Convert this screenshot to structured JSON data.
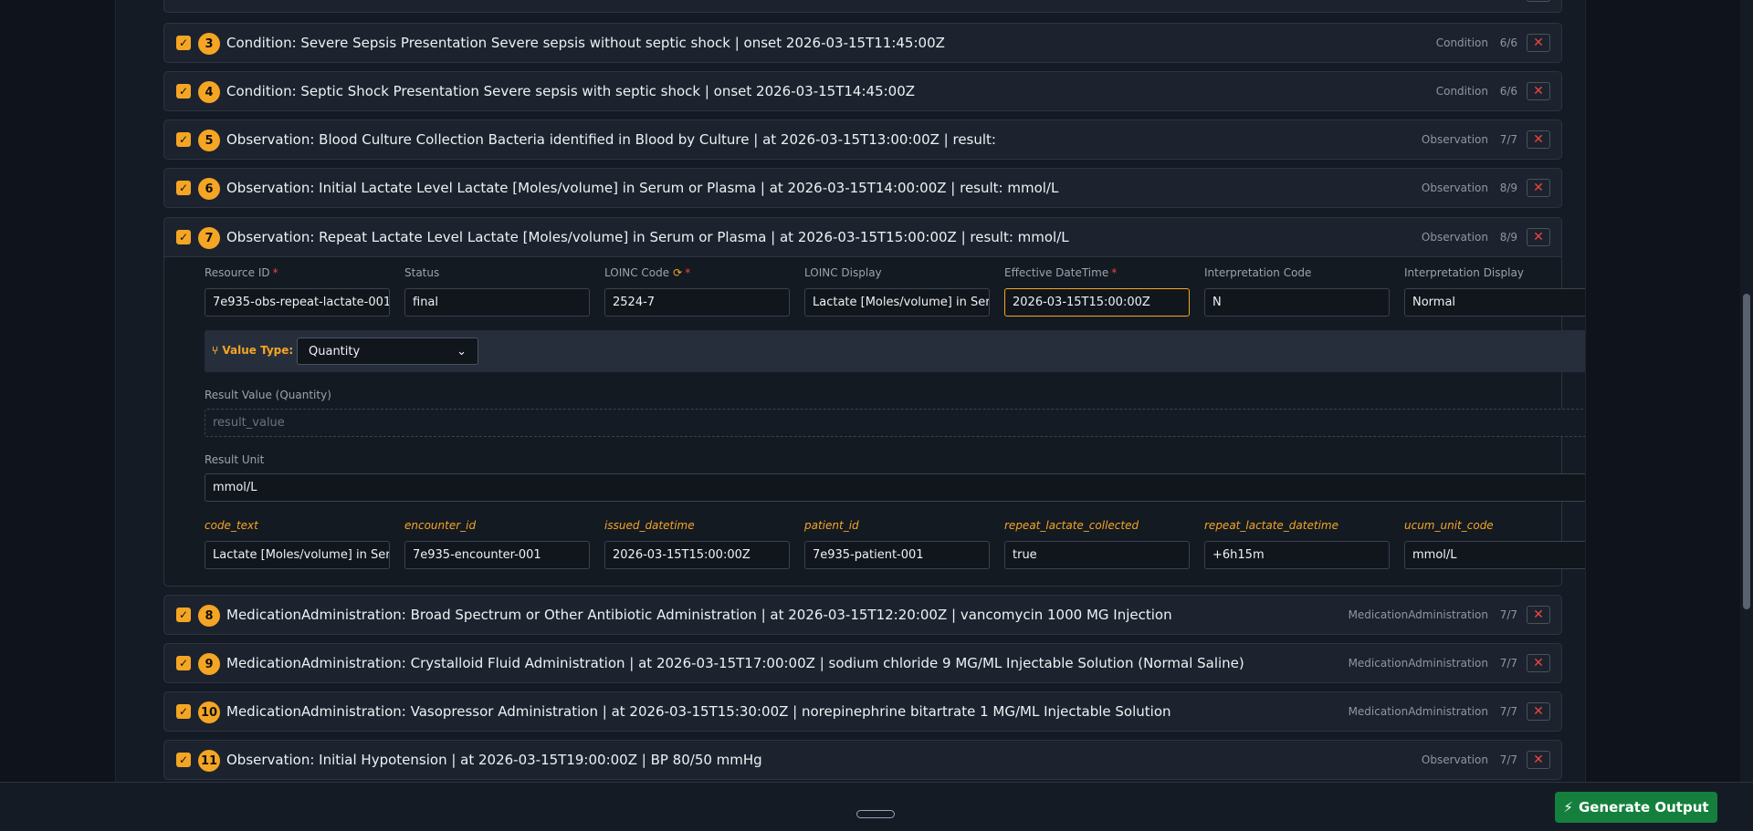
{
  "rows": [
    {
      "num": "3",
      "title": "Condition: Severe Sepsis Presentation Severe sepsis without septic shock | onset 2026-03-15T11:45:00Z",
      "type": "Condition",
      "count": "6/6"
    },
    {
      "num": "4",
      "title": "Condition: Septic Shock Presentation Severe sepsis with septic shock | onset 2026-03-15T14:45:00Z",
      "type": "Condition",
      "count": "6/6"
    },
    {
      "num": "5",
      "title": "Observation: Blood Culture Collection Bacteria identified in Blood by Culture | at 2026-03-15T13:00:00Z | result:",
      "type": "Observation",
      "count": "7/7"
    },
    {
      "num": "6",
      "title": "Observation: Initial Lactate Level Lactate [Moles/volume] in Serum or Plasma | at 2026-03-15T14:00:00Z | result: mmol/L",
      "type": "Observation",
      "count": "8/9"
    },
    {
      "num": "7",
      "title": "Observation: Repeat Lactate Level Lactate [Moles/volume] in Serum or Plasma | at 2026-03-15T15:00:00Z | result: mmol/L",
      "type": "Observation",
      "count": "8/9"
    },
    {
      "num": "8",
      "title": "MedicationAdministration: Broad Spectrum or Other Antibiotic Administration | at 2026-03-15T12:20:00Z | vancomycin 1000 MG Injection",
      "type": "MedicationAdministration",
      "count": "7/7"
    },
    {
      "num": "9",
      "title": "MedicationAdministration: Crystalloid Fluid Administration | at 2026-03-15T17:00:00Z | sodium chloride 9 MG/ML Injectable Solution (Normal Saline)",
      "type": "MedicationAdministration",
      "count": "7/7"
    },
    {
      "num": "10",
      "title": "MedicationAdministration: Vasopressor Administration | at 2026-03-15T15:30:00Z | norepinephrine bitartrate 1 MG/ML Injectable Solution",
      "type": "MedicationAdministration",
      "count": "7/7"
    },
    {
      "num": "11",
      "title": "Observation: Initial Hypotension | at 2026-03-15T19:00:00Z | BP 80/50 mmHg",
      "type": "Observation",
      "count": "7/7"
    }
  ],
  "detail": {
    "fields": [
      {
        "label": "Resource ID",
        "value": "7e935-obs-repeat-lactate-001"
      },
      {
        "label": "Status",
        "value": "final"
      },
      {
        "label": "LOINC Code",
        "value": "2524-7"
      },
      {
        "label": "LOINC Display",
        "value": "Lactate [Moles/volume] in Seru"
      },
      {
        "label": "Effective DateTime",
        "value": "2026-03-15T15:00:00Z"
      },
      {
        "label": "Interpretation Code",
        "value": "N"
      },
      {
        "label": "Interpretation Display",
        "value": "Normal"
      }
    ],
    "value_type_label": "Value Type:",
    "value_type_selected": "Quantity",
    "result_value_label": "Result Value (Quantity)",
    "result_value_placeholder": "result_value",
    "result_unit_label": "Result Unit",
    "result_unit_value": "mmol/L",
    "custom_fields": [
      {
        "label": "code_text",
        "value": "Lactate [Moles/volume] in Seru"
      },
      {
        "label": "encounter_id",
        "value": "7e935-encounter-001"
      },
      {
        "label": "issued_datetime",
        "value": "2026-03-15T15:00:00Z"
      },
      {
        "label": "patient_id",
        "value": "7e935-patient-001"
      },
      {
        "label": "repeat_lactate_collected",
        "value": "true"
      },
      {
        "label": "repeat_lactate_datetime",
        "value": "+6h15m"
      },
      {
        "label": "ucum_unit_code",
        "value": "mmol/L"
      }
    ]
  },
  "footer": {
    "generate_label": "Generate Output"
  },
  "colors": {
    "accent": "#f5a524",
    "danger": "#ef4444",
    "success": "#15803d"
  }
}
